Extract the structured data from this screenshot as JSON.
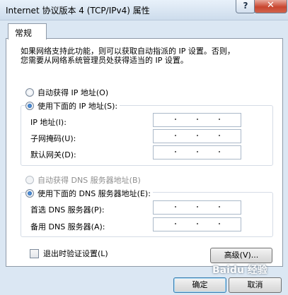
{
  "window": {
    "title": "Internet 协议版本 4 (TCP/IPv4) 属性",
    "help_label": "?",
    "close_label": "✕"
  },
  "tabs": [
    {
      "label": "常规"
    }
  ],
  "description_line1": "如果网络支持此功能，则可以获取自动指派的 IP 设置。否则，",
  "description_line2": "您需要从网络系统管理员处获得适当的 IP 设置。",
  "ip": {
    "auto_label": "自动获得 IP 地址(O)",
    "manual_label": "使用下面的 IP 地址(S):",
    "selected": "manual",
    "fields": [
      {
        "label": "IP 地址(I):",
        "value": ". . ."
      },
      {
        "label": "子网掩码(U):",
        "value": ". . ."
      },
      {
        "label": "默认网关(D):",
        "value": ". . ."
      }
    ]
  },
  "dns": {
    "auto_label": "自动获得 DNS 服务器地址(B)",
    "auto_enabled": false,
    "manual_label": "使用下面的 DNS 服务器地址(E):",
    "selected": "manual",
    "fields": [
      {
        "label": "首选 DNS 服务器(P):",
        "value": ". . ."
      },
      {
        "label": "备用 DNS 服务器(A):",
        "value": ". . ."
      }
    ]
  },
  "validate_label": "退出时验证设置(L)",
  "validate_checked": false,
  "advanced_label": "高级(V)...",
  "ok_label": "确定",
  "cancel_label": "取消",
  "watermark": "Baidu 经验"
}
